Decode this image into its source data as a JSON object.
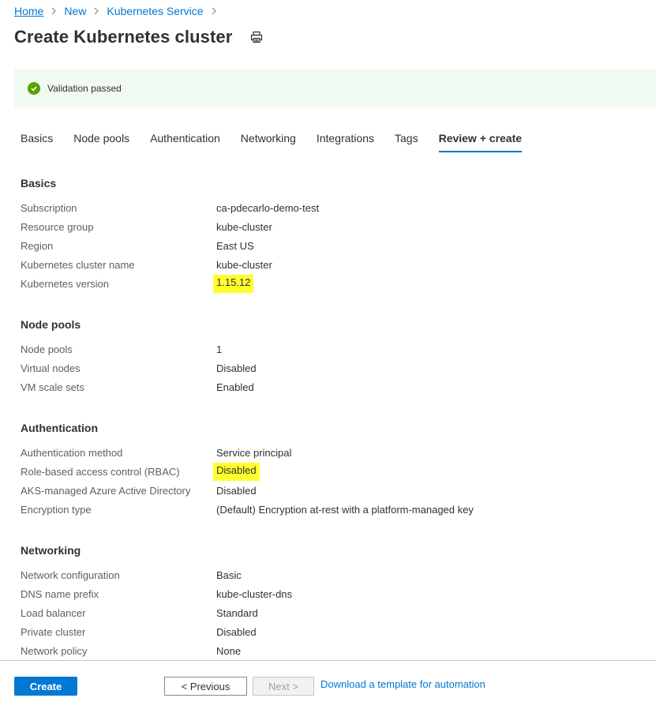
{
  "breadcrumb": {
    "home": "Home",
    "new": "New",
    "service": "Kubernetes Service"
  },
  "page": {
    "title": "Create Kubernetes cluster"
  },
  "validation": {
    "message": "Validation passed"
  },
  "tabs": [
    {
      "label": "Basics"
    },
    {
      "label": "Node pools"
    },
    {
      "label": "Authentication"
    },
    {
      "label": "Networking"
    },
    {
      "label": "Integrations"
    },
    {
      "label": "Tags"
    },
    {
      "label": "Review + create",
      "active": true
    }
  ],
  "sections": {
    "basics": {
      "title": "Basics",
      "rows": [
        {
          "label": "Subscription",
          "value": "ca-pdecarlo-demo-test"
        },
        {
          "label": "Resource group",
          "value": "kube-cluster"
        },
        {
          "label": "Region",
          "value": "East US"
        },
        {
          "label": "Kubernetes cluster name",
          "value": "kube-cluster"
        },
        {
          "label": "Kubernetes version",
          "value": "1.15.12"
        }
      ]
    },
    "node_pools": {
      "title": "Node pools",
      "rows": [
        {
          "label": "Node pools",
          "value": "1"
        },
        {
          "label": "Virtual nodes",
          "value": "Disabled"
        },
        {
          "label": "VM scale sets",
          "value": "Enabled"
        }
      ]
    },
    "authentication": {
      "title": "Authentication",
      "rows": [
        {
          "label": "Authentication method",
          "value": "Service principal"
        },
        {
          "label": "Role-based access control (RBAC)",
          "value": "Disabled"
        },
        {
          "label": "AKS-managed Azure Active Directory",
          "value": "Disabled"
        },
        {
          "label": "Encryption type",
          "value": "(Default) Encryption at-rest with a platform-managed key"
        }
      ]
    },
    "networking": {
      "title": "Networking",
      "rows": [
        {
          "label": "Network configuration",
          "value": "Basic"
        },
        {
          "label": "DNS name prefix",
          "value": "kube-cluster-dns"
        },
        {
          "label": "Load balancer",
          "value": "Standard"
        },
        {
          "label": "Private cluster",
          "value": "Disabled"
        },
        {
          "label": "Network policy",
          "value": "None"
        }
      ]
    }
  },
  "footer": {
    "create_label": "Create",
    "previous_label": "< Previous",
    "next_label": "Next >",
    "template_link": "Download a template for automation"
  },
  "icons": {
    "print": "print-icon",
    "check": "checkmark-circle-icon",
    "chevron": "chevron-right-icon"
  },
  "colors": {
    "accent": "#0078d4",
    "success": "#57a300",
    "success_bg": "#f1faf0",
    "highlight": "#ffff2e"
  }
}
